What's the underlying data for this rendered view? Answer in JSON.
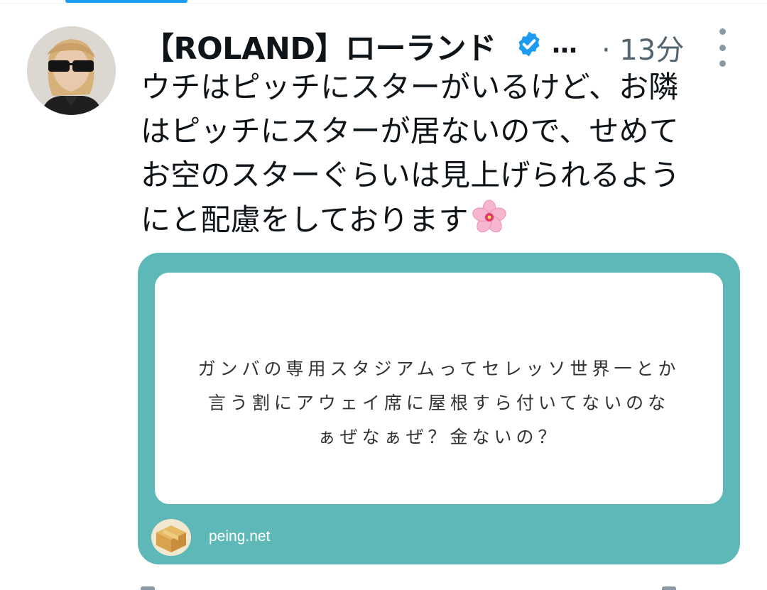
{
  "tweet": {
    "author": {
      "display_name": "【ROLAND】ローランド",
      "name_overflow": "…",
      "avatar_icon": "profile-photo"
    },
    "timestamp": "· 13分",
    "text_lines": [
      "ウチはピッチにスターがいるけど、お隣",
      "はピッチにスターが居ないので、せめて",
      "お空のスターぐらいは見上げられるよう",
      "にと配慮をしております"
    ],
    "emoji": "cherry-blossom"
  },
  "card": {
    "question_lines": [
      "ガンバの専用スタジアムってセレッソ世界一とか",
      "言う割にアウェイ席に屋根すら付いてないのな",
      "ぁぜなぁぜ？金ないの？"
    ],
    "source": "peing.net",
    "source_icon": "cardboard-box-icon"
  },
  "colors": {
    "verified_blue": "#1d9bf0",
    "card_teal": "#5fb8b8",
    "secondary_text": "#536471"
  }
}
